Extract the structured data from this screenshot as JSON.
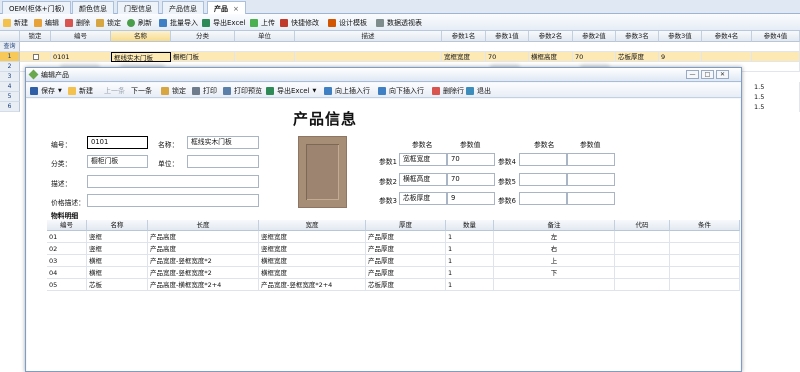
{
  "tabs": [
    {
      "label": "OEM(柜体+门板)"
    },
    {
      "label": "颜色信息"
    },
    {
      "label": "门型信息"
    },
    {
      "label": "产品信息"
    },
    {
      "label": "产品",
      "close": "×"
    }
  ],
  "toolbar": {
    "new": "新建",
    "edit": "编辑",
    "delete": "删除",
    "lock": "锁定",
    "refresh": "刷新",
    "batch_import": "批量导入",
    "export_excel": "导出Excel",
    "upload": "上传",
    "quick_edit": "快捷修改",
    "design_template": "设计模板",
    "pivot": "数据透视表"
  },
  "grid": {
    "query_label": "查询",
    "columns": [
      "锁定",
      "编号",
      "名称",
      "分类",
      "单位",
      "描述",
      "参数1名",
      "参数1值",
      "参数2名",
      "参数2值",
      "参数3名",
      "参数3值",
      "参数4名",
      "参数4值"
    ],
    "row1": {
      "num": "1",
      "code": "0101",
      "name": "框线实木门板",
      "category": "橱柜门板",
      "p1n": "宽框宽度",
      "p1v": "70",
      "p2n": "横框高度",
      "p2v": "70",
      "p3n": "芯板厚度",
      "p3v": "9"
    },
    "row_numbers": [
      "2",
      "3",
      "4",
      "5",
      "6"
    ],
    "right_values": [
      "1.5",
      "1.5",
      "1.5"
    ]
  },
  "dialog": {
    "title": "编辑产品",
    "buttons": {
      "save": "保存",
      "new": "新建",
      "prev": "上一条",
      "next": "下一条",
      "lock": "锁定",
      "print": "打印",
      "print_preview": "打印预览",
      "export_excel": "导出Excel",
      "insert_above": "向上插入行",
      "insert_below": "向下插入行",
      "delete_row": "删除行",
      "exit": "退出"
    },
    "heading": "产品信息",
    "form": {
      "code_label": "编号：",
      "code_value": "0101",
      "name_label": "名称：",
      "name_value": "框线实木门板",
      "category_label": "分类：",
      "category_value": "橱柜门板",
      "unit_label": "单位：",
      "unit_value": "",
      "desc_label": "描述：",
      "desc_value": "",
      "price_desc_label": "价格描述：",
      "price_desc_value": ""
    },
    "params": {
      "name_header": "参数名",
      "value_header": "参数值",
      "name_header2": "参数名",
      "value_header2": "参数值",
      "p1_label": "参数1",
      "p1_name": "宽框宽度",
      "p1_value": "70",
      "p2_label": "参数2",
      "p2_name": "横框高度",
      "p2_value": "70",
      "p3_label": "参数3",
      "p3_name": "芯板厚度",
      "p3_value": "9",
      "p4_label": "参数4",
      "p5_label": "参数5",
      "p6_label": "参数6"
    },
    "bom": {
      "section_label": "物料明细",
      "columns": [
        "编号",
        "名称",
        "长度",
        "宽度",
        "厚度",
        "数量",
        "备注",
        "代码",
        "条件"
      ],
      "rows": [
        {
          "code": "01",
          "name": "竖框",
          "length": "产品高度",
          "width": "竖框宽度",
          "thick": "产品厚度",
          "qty": "1",
          "note": "左"
        },
        {
          "code": "02",
          "name": "竖框",
          "length": "产品高度",
          "width": "竖框宽度",
          "thick": "产品厚度",
          "qty": "1",
          "note": "右"
        },
        {
          "code": "03",
          "name": "横框",
          "length": "产品宽度-竖框宽度*2",
          "width": "横框宽度",
          "thick": "产品厚度",
          "qty": "1",
          "note": "上"
        },
        {
          "code": "04",
          "name": "横框",
          "length": "产品宽度-竖框宽度*2",
          "width": "横框宽度",
          "thick": "产品厚度",
          "qty": "1",
          "note": "下"
        },
        {
          "code": "05",
          "name": "芯板",
          "length": "产品高度-横框宽度*2+4",
          "width": "产品宽度-竖框宽度*2+4",
          "thick": "芯板厚度",
          "qty": "1",
          "note": ""
        }
      ]
    }
  }
}
